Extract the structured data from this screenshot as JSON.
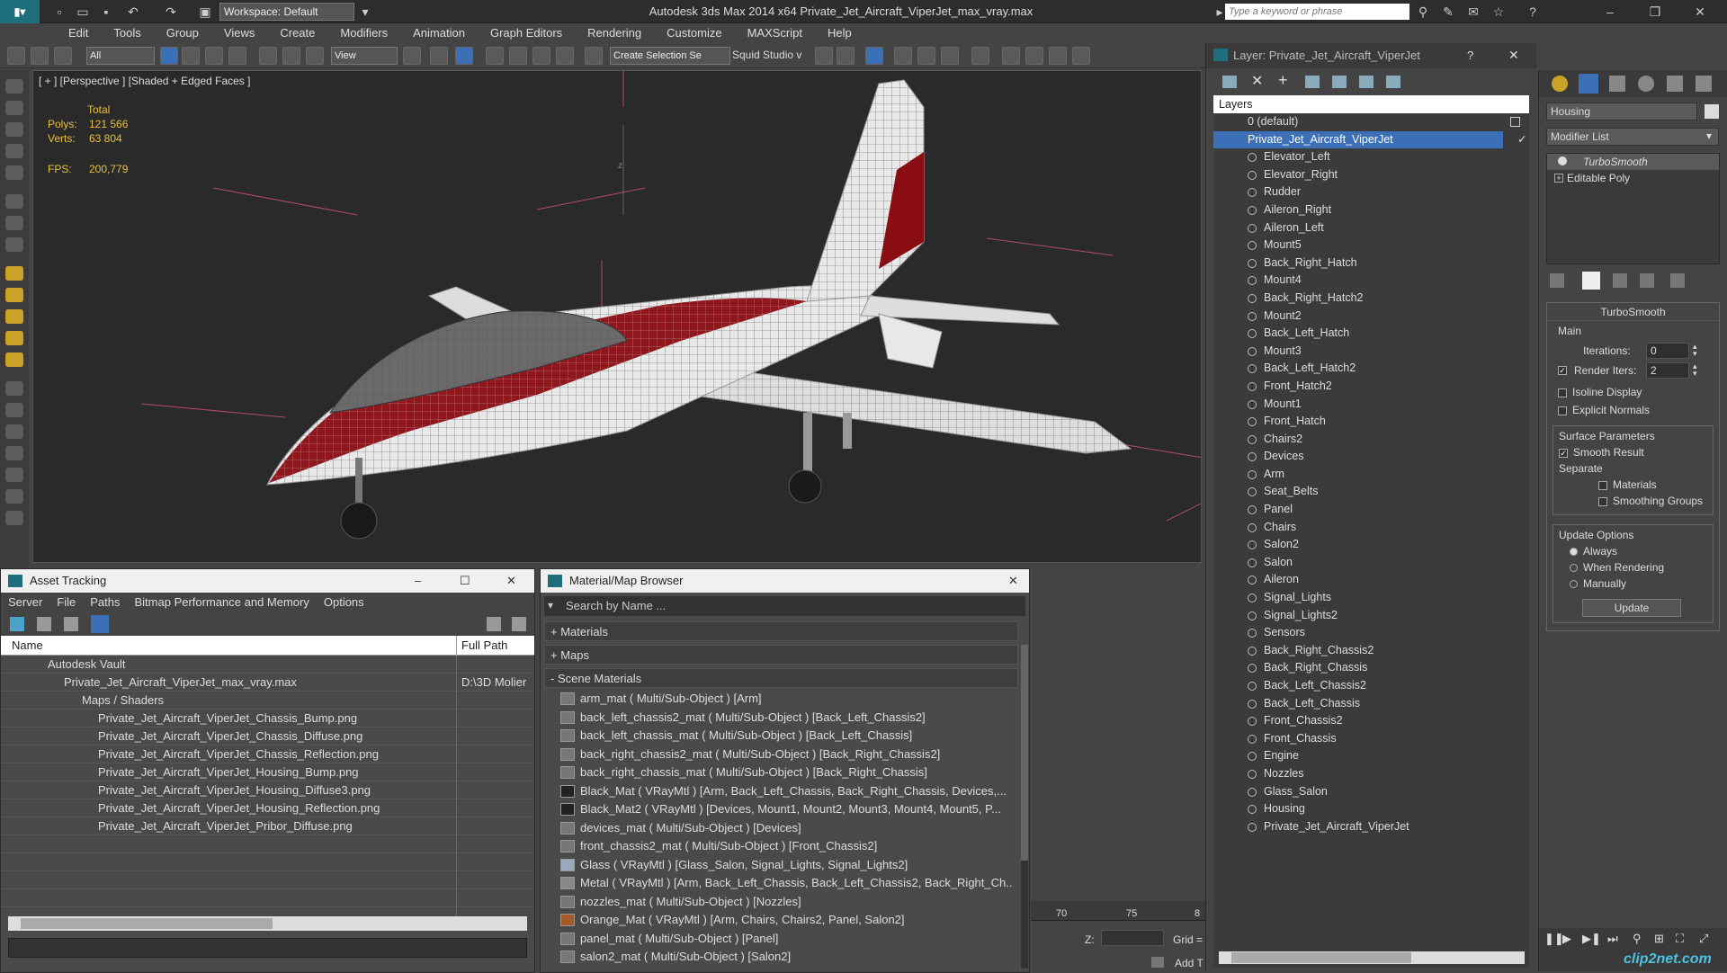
{
  "app": {
    "window_title": "Autodesk 3ds Max  2014 x64      Private_Jet_Aircraft_ViperJet_max_vray.max",
    "workspace": "Workspace: Default",
    "search_placeholder": "Type a keyword or phrase"
  },
  "menu": [
    "Edit",
    "Tools",
    "Group",
    "Views",
    "Create",
    "Modifiers",
    "Animation",
    "Graph Editors",
    "Rendering",
    "Customize",
    "MAXScript",
    "Help"
  ],
  "toolbar": {
    "filter_select": "All",
    "ref_coord": "View",
    "selection_set": "Create Selection Se",
    "squid": "Squid Studio v"
  },
  "viewport": {
    "label": "[ + ] [Perspective ] [Shaded + Edged Faces ]",
    "total_label": "Total",
    "polys_label": "Polys:",
    "polys": "121 566",
    "verts_label": "Verts:",
    "verts": "63 804",
    "fps_label": "FPS:",
    "fps": "200,779",
    "axis_z": "z"
  },
  "asset_tracking": {
    "title": "Asset Tracking",
    "menu": [
      "Server",
      "File",
      "Paths",
      "Bitmap Performance and Memory",
      "Options"
    ],
    "col_name": "Name",
    "col_path": "Full Path",
    "rows": [
      {
        "name": "Autodesk Vault",
        "path": ""
      },
      {
        "name": "Private_Jet_Aircraft_ViperJet_max_vray.max",
        "path": "D:\\3D Molier"
      },
      {
        "name": "Maps / Shaders",
        "path": ""
      },
      {
        "name": "Private_Jet_Aircraft_ViperJet_Chassis_Bump.png",
        "path": ""
      },
      {
        "name": "Private_Jet_Aircraft_ViperJet_Chassis_Diffuse.png",
        "path": ""
      },
      {
        "name": "Private_Jet_Aircraft_ViperJet_Chassis_Reflection.png",
        "path": ""
      },
      {
        "name": "Private_Jet_Aircraft_ViperJet_Housing_Bump.png",
        "path": ""
      },
      {
        "name": "Private_Jet_Aircraft_ViperJet_Housing_Diffuse3.png",
        "path": ""
      },
      {
        "name": "Private_Jet_Aircraft_ViperJet_Housing_Reflection.png",
        "path": ""
      },
      {
        "name": "Private_Jet_Aircraft_ViperJet_Pribor_Diffuse.png",
        "path": ""
      }
    ]
  },
  "material_browser": {
    "title": "Material/Map Browser",
    "search_placeholder": "Search by Name ...",
    "sections": [
      "+ Materials",
      "+ Maps",
      "- Scene Materials"
    ],
    "items": [
      "arm_mat  ( Multi/Sub-Object ) [Arm]",
      "back_left_chassis2_mat  ( Multi/Sub-Object ) [Back_Left_Chassis2]",
      "back_left_chassis_mat  ( Multi/Sub-Object ) [Back_Left_Chassis]",
      "back_right_chassis2_mat  ( Multi/Sub-Object ) [Back_Right_Chassis2]",
      "back_right_chassis_mat  ( Multi/Sub-Object ) [Back_Right_Chassis]",
      "Black_Mat  ( VRayMtl ) [Arm, Back_Left_Chassis, Back_Right_Chassis, Devices,...",
      "Black_Mat2  ( VRayMtl ) [Devices, Mount1, Mount2, Mount3, Mount4, Mount5, P...",
      "devices_mat  ( Multi/Sub-Object ) [Devices]",
      "front_chassis2_mat  ( Multi/Sub-Object ) [Front_Chassis2]",
      "Glass  ( VRayMtl ) [Glass_Salon, Signal_Lights, Signal_Lights2]",
      "Metal  ( VRayMtl ) [Arm, Back_Left_Chassis, Back_Left_Chassis2, Back_Right_Ch...",
      "nozzles_mat  ( Multi/Sub-Object ) [Nozzles]",
      "Orange_Mat  ( VRayMtl ) [Arm, Chairs, Chairs2, Panel, Salon2]",
      "panel_mat  ( Multi/Sub-Object ) [Panel]",
      "salon2_mat  ( Multi/Sub-Object ) [Salon2]"
    ]
  },
  "timeline": {
    "t70": "70",
    "t75": "75",
    "t80": "8",
    "z_label": "Z:",
    "grid": "Grid =",
    "addt": "Add T"
  },
  "layers": {
    "title": "Layer: Private_Jet_Aircraft_ViperJet",
    "help": "?",
    "header": "Layers",
    "default_layer": "0 (default)",
    "selected_layer": "Private_Jet_Aircraft_ViperJet",
    "items": [
      "Elevator_Left",
      "Elevator_Right",
      "Rudder",
      "Aileron_Right",
      "Aileron_Left",
      "Mount5",
      "Back_Right_Hatch",
      "Mount4",
      "Back_Right_Hatch2",
      "Mount2",
      "Back_Left_Hatch",
      "Mount3",
      "Back_Left_Hatch2",
      "Front_Hatch2",
      "Mount1",
      "Front_Hatch",
      "Chairs2",
      "Devices",
      "Arm",
      "Seat_Belts",
      "Panel",
      "Chairs",
      "Salon2",
      "Salon",
      "Aileron",
      "Signal_Lights",
      "Signal_Lights2",
      "Sensors",
      "Back_Right_Chassis2",
      "Back_Right_Chassis",
      "Back_Left_Chassis2",
      "Back_Left_Chassis",
      "Front_Chassis2",
      "Front_Chassis",
      "Engine",
      "Nozzles",
      "Glass_Salon",
      "Housing",
      "Private_Jet_Aircraft_ViperJet"
    ]
  },
  "command_panel": {
    "object_name": "Housing",
    "modifier_list": "Modifier List",
    "stack": [
      "TurboSmooth",
      "Editable Poly"
    ],
    "rollout": "TurboSmooth",
    "main": "Main",
    "iterations_label": "Iterations:",
    "iterations": "0",
    "render_iters_label": "Render Iters:",
    "render_iters": "2",
    "isoline": "Isoline Display",
    "explicit": "Explicit Normals",
    "surface_params": "Surface Parameters",
    "smooth_result": "Smooth Result",
    "separate": "Separate",
    "materials": "Materials",
    "smoothing_groups": "Smoothing Groups",
    "update_options": "Update Options",
    "always": "Always",
    "when_rendering": "When Rendering",
    "manually": "Manually",
    "update_btn": "Update"
  },
  "watermark": "clip2net.com",
  "colors": {
    "accent": "#3b6fb6",
    "jet_red": "#8a0d14",
    "viewport_bg": "#2a2a2a"
  }
}
